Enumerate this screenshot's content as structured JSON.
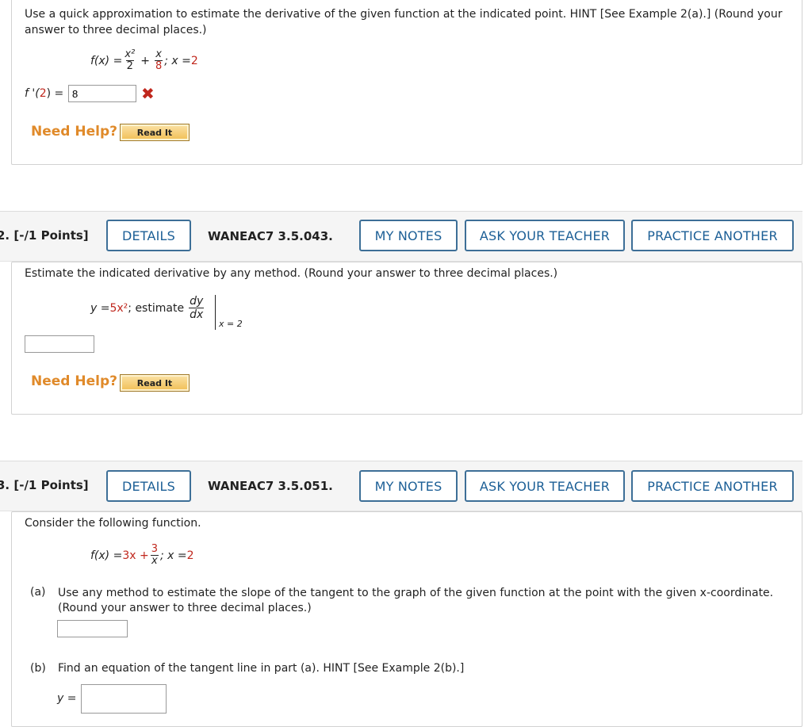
{
  "q1": {
    "instruction": "Use a quick approximation to estimate the derivative of the given function at the indicated point. HINT [See Example 2(a).] (Round your answer to three decimal places.)",
    "func_lhs": "f(x) = ",
    "frac1_num": "x²",
    "frac1_den": "2",
    "plus": "+",
    "frac2_num": "x",
    "frac2_den": "8",
    "point_sep": "; x = ",
    "point_val": "2",
    "answer_prefix": "f '(",
    "answer_point": "2",
    "answer_suffix": ") =",
    "answer_value": "8",
    "wrong_icon": "x-mark-icon",
    "need_help": "Need Help?",
    "read_it": "Read It"
  },
  "q2": {
    "number": "2.",
    "points": "[-/1 Points]",
    "details": "DETAILS",
    "code": "WANEAC7 3.5.043.",
    "my_notes": "MY NOTES",
    "ask_teacher": "ASK YOUR TEACHER",
    "practice": "PRACTICE ANOTHER",
    "instruction": "Estimate the indicated derivative by any method. (Round your answer to three decimal places.)",
    "y_lhs": "y = ",
    "y_rhs": "5x²",
    "estimate": "; estimate",
    "dy": "dy",
    "dx": "dx",
    "eval_at": "x = 2",
    "answer_value": "",
    "need_help": "Need Help?",
    "read_it": "Read It"
  },
  "q3": {
    "number": "3.",
    "points": "[-/1 Points]",
    "details": "DETAILS",
    "code": "WANEAC7 3.5.051.",
    "my_notes": "MY NOTES",
    "ask_teacher": "ASK YOUR TEACHER",
    "practice": "PRACTICE ANOTHER",
    "intro": "Consider the following function.",
    "func_lhs": "f(x) = ",
    "func_a": "3x + ",
    "frac_num": "3",
    "frac_den": "x",
    "point_sep": "; x = ",
    "point_val": "2",
    "part_a_label": "(a)",
    "part_a_text": "Use any method to estimate the slope of the tangent to the graph of the given function at the point with the given x-coordinate. (Round your answer to three decimal places.)",
    "part_a_value": "",
    "part_b_label": "(b)",
    "part_b_text": "Find an equation of the tangent line in part (a). HINT [See Example 2(b).]",
    "y_eq": "y =",
    "part_b_value": ""
  },
  "colors": {
    "accent": "#1c5f96",
    "error": "#c0271d",
    "help": "#e08a2a"
  }
}
